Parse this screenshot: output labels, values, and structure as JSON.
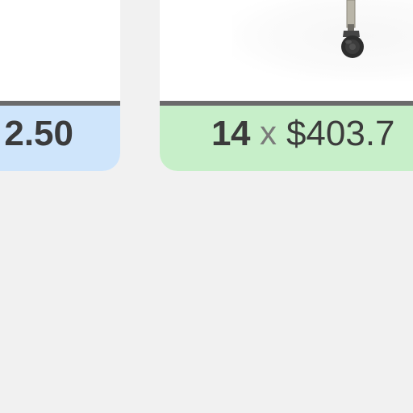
{
  "products": [
    {
      "quantity": "",
      "times_symbol": "",
      "price": "2.50",
      "footer_color": "#cfe5fb"
    },
    {
      "quantity": "14",
      "times_symbol": "x",
      "price": "$403.7",
      "footer_color": "#c7efc9",
      "image_icon": "office-chair-caster-icon"
    }
  ],
  "colors": {
    "background": "#f1f1f1",
    "divider": "#6b6b6b",
    "text": "#3b3b3b",
    "muted_text": "#7a7a7a"
  }
}
